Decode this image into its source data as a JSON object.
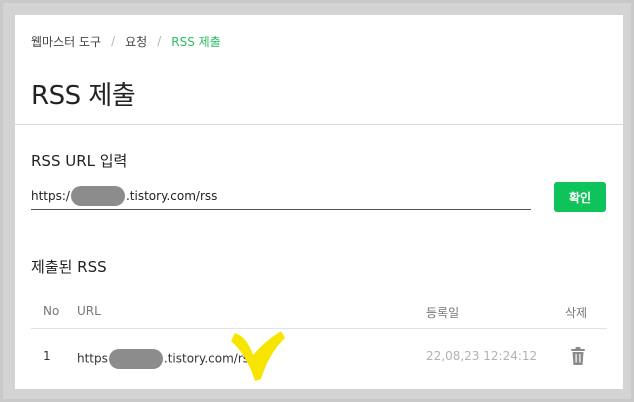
{
  "breadcrumb": {
    "items": [
      "웹마스터 도구",
      "요청",
      "RSS 제출"
    ],
    "separator": "/"
  },
  "page_title": "RSS 제출",
  "rss_input": {
    "label": "RSS URL 입력",
    "value_prefix": "https:/",
    "value_suffix": ".tistory.com/rss",
    "confirm_label": "확인"
  },
  "submitted": {
    "title": "제출된 RSS",
    "headers": {
      "no": "No",
      "url": "URL",
      "date": "등록일",
      "delete": "삭제"
    },
    "rows": [
      {
        "no": "1",
        "url_prefix": "https",
        "url_suffix": ".tistory.com/rss",
        "date": "22,08,23 12:24:12",
        "delete_icon": "trash-icon"
      }
    ]
  },
  "colors": {
    "accent": "#2dbc5f",
    "button": "#0ec35a",
    "annotation": "#f7e500"
  }
}
